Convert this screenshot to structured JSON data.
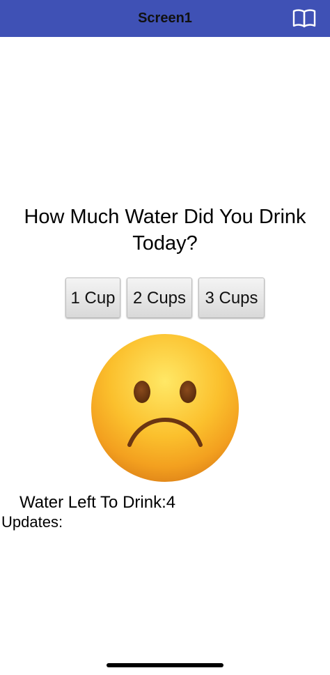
{
  "titlebar": {
    "title": "Screen1",
    "background_color": "#3f51b5",
    "icon": "book-icon"
  },
  "main": {
    "question": "How Much Water Did You Drink Today?",
    "buttons": [
      {
        "label": "1 Cup"
      },
      {
        "label": "2 Cups"
      },
      {
        "label": "3 Cups"
      }
    ],
    "mood_icon": "sad-face-icon",
    "water_left_label": "Water Left To Drink:",
    "water_left_value": "4",
    "updates_label": "Updates:"
  }
}
